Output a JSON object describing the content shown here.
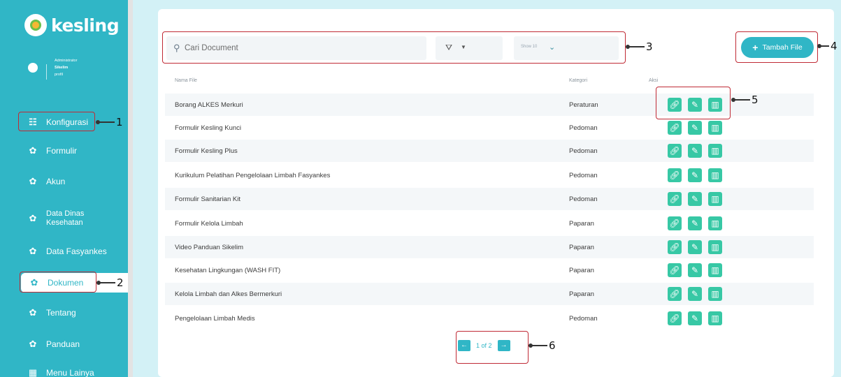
{
  "app": {
    "logo_text": "kesling"
  },
  "profile": {
    "line1": "Administrator",
    "line2": "Sikelim",
    "line3": "profil"
  },
  "sidebar": {
    "items": [
      {
        "label": "Konfigurasi",
        "icon": "sliders-icon"
      },
      {
        "label": "Formulir",
        "icon": "gear-icon"
      },
      {
        "label": "Akun",
        "icon": "gear-icon"
      },
      {
        "label": "Data Dinas Kesehatan",
        "icon": "gear-icon"
      },
      {
        "label": "Data Fasyankes",
        "icon": "gear-icon"
      },
      {
        "label": "Dokumen",
        "icon": "gear-icon"
      },
      {
        "label": "Tentang",
        "icon": "gear-icon"
      },
      {
        "label": "Panduan",
        "icon": "gear-icon"
      },
      {
        "label": "Menu Lainya",
        "icon": "grid-icon"
      }
    ]
  },
  "toolbar": {
    "search_placeholder": "Cari Document",
    "show_label": "Show 10",
    "add_label": "Tambah File"
  },
  "table": {
    "headers": {
      "name": "Nama File",
      "category": "Kategori",
      "action": "Aksi"
    },
    "rows": [
      {
        "name": "Borang ALKES Merkuri",
        "category": "Peraturan"
      },
      {
        "name": "Formulir Kesling Kunci",
        "category": "Pedoman"
      },
      {
        "name": "Formulir Kesling Plus",
        "category": "Pedoman"
      },
      {
        "name": "Kurikulum Pelatihan Pengelolaan Limbah Fasyankes",
        "category": "Pedoman"
      },
      {
        "name": "Formulir Sanitarian Kit",
        "category": "Pedoman"
      },
      {
        "name": "Formulir Kelola Limbah",
        "category": "Paparan"
      },
      {
        "name": "Video Panduan Sikelim",
        "category": "Paparan"
      },
      {
        "name": "Kesehatan Lingkungan (WASH FIT)",
        "category": "Paparan"
      },
      {
        "name": "Kelola Limbah dan Alkes Bermerkuri",
        "category": "Paparan"
      },
      {
        "name": "Pengelolaan Limbah Medis",
        "category": "Pedoman"
      }
    ]
  },
  "pagination": {
    "text": "1 of 2"
  },
  "callouts": {
    "c1": "1",
    "c2": "2",
    "c3": "3",
    "c4": "4",
    "c5": "5",
    "c6": "6"
  },
  "colors": {
    "accent": "#30b6c6",
    "action": "#37c8a5",
    "highlight": "#c02a35",
    "background": "#d3f1f6"
  }
}
